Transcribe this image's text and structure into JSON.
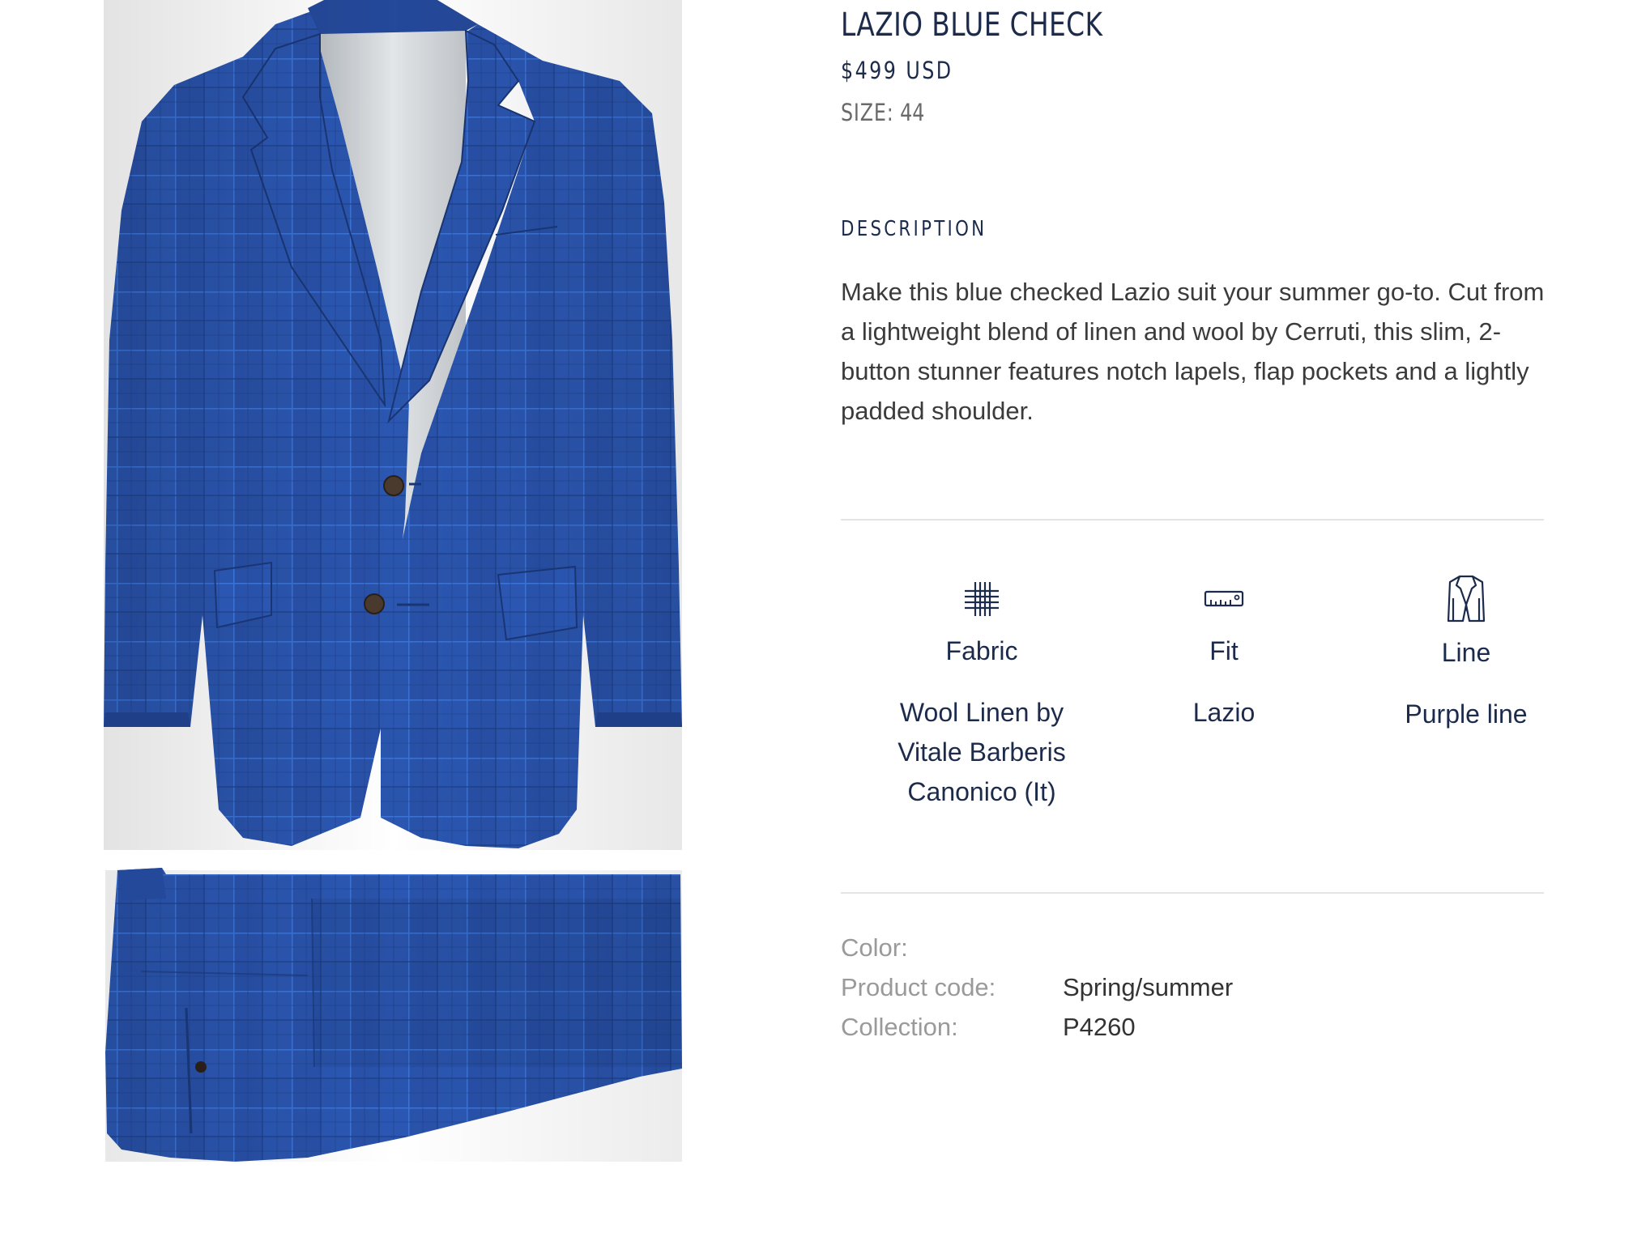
{
  "product": {
    "title": "LAZIO BLUE CHECK",
    "price": "$499 USD",
    "size_label": "SIZE:",
    "size_value": "44"
  },
  "description": {
    "heading": "DESCRIPTION",
    "text": "Make this blue checked Lazio suit your summer go-to. Cut from a lightweight blend of linen and wool by Cerruti, this slim, 2-button stunner features notch lapels, flap pockets and a lightly padded shoulder."
  },
  "features": [
    {
      "icon": "fabric-grid-icon",
      "label": "Fabric",
      "value": "Wool Linen by Vitale Barberis Canonico (It)"
    },
    {
      "icon": "ruler-icon",
      "label": "Fit",
      "value": "Lazio"
    },
    {
      "icon": "jacket-icon",
      "label": "Line",
      "value": "Purple line"
    }
  ],
  "specs": [
    {
      "key": "Color:",
      "value": ""
    },
    {
      "key": "Product code:",
      "value": "Spring/summer"
    },
    {
      "key": "Collection:",
      "value": "P4260"
    }
  ],
  "colors": {
    "navy_text": "#1c2b4b",
    "suit_blue": "#2b56b0",
    "divider": "#e4e4e4",
    "muted_text": "#9a9a9a"
  }
}
